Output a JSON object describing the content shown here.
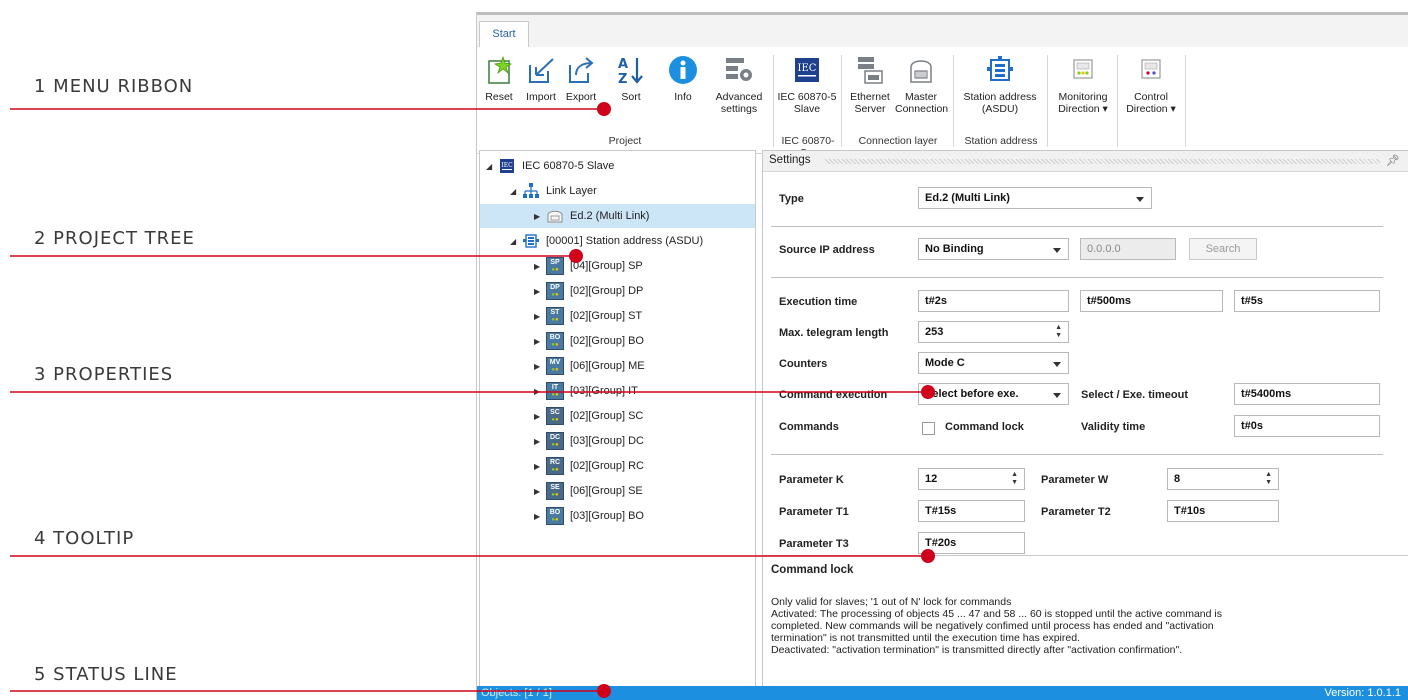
{
  "callouts": [
    "1 MENU RIBBON",
    "2 PROJECT TREE",
    "3 PROPERTIES",
    "4 TOOLTIP",
    "5 STATUS LINE"
  ],
  "colors": {
    "callout_line": "#d0021b",
    "status_bar": "#1c8fe0",
    "selection": "#cde6f7"
  },
  "tabs": {
    "start": "Start"
  },
  "ribbon": {
    "reset": "Reset",
    "import": "Import",
    "export": "Export",
    "sort": "Sort",
    "info": "Info",
    "advanced_1": "Advanced",
    "advanced_2": "settings",
    "iec_1": "IEC 60870-5",
    "iec_2": "Slave",
    "eth_1": "Ethernet",
    "eth_2": "Server",
    "master_1": "Master",
    "master_2": "Connection",
    "station_1": "Station address",
    "station_2": "(ASDU)",
    "mon_1": "Monitoring",
    "mon_2": "Direction ▾",
    "ctrl_1": "Control",
    "ctrl_2": "Direction ▾",
    "group_project": "Project",
    "group_iec": "IEC 60870-5...",
    "group_conn": "Connection layer",
    "group_station": "Station address",
    "iec_badge": "IEC"
  },
  "tree": {
    "root": "IEC 60870-5 Slave",
    "link_layer": "Link Layer",
    "ed2": "Ed.2 (Multi Link)",
    "station": "[00001] Station address (ASDU)",
    "groups": [
      {
        "badge": "SP",
        "label": "[04][Group] SP"
      },
      {
        "badge": "DP",
        "label": "[02][Group] DP"
      },
      {
        "badge": "ST",
        "label": "[02][Group] ST"
      },
      {
        "badge": "BO",
        "label": "[02][Group] BO"
      },
      {
        "badge": "MV",
        "label": "[06][Group] ME"
      },
      {
        "badge": "IT",
        "label": "[03][Group] IT"
      },
      {
        "badge": "SC",
        "label": "[02][Group] SC"
      },
      {
        "badge": "DC",
        "label": "[03][Group] DC"
      },
      {
        "badge": "RC",
        "label": "[02][Group] RC"
      },
      {
        "badge": "SE",
        "label": "[06][Group] SE"
      },
      {
        "badge": "BO",
        "label": "[03][Group] BO"
      }
    ]
  },
  "settings": {
    "title": "Settings",
    "type_label": "Type",
    "type_value": "Ed.2 (Multi Link)",
    "source_ip_label": "Source IP address",
    "binding_value": "No Binding",
    "ip_value": "0.0.0.0",
    "search_button": "Search",
    "exec_time_label": "Execution time",
    "exec_1": "t#2s",
    "exec_2": "t#500ms",
    "exec_3": "t#5s",
    "max_tel_label": "Max. telegram length",
    "max_tel_value": "253",
    "counters_label": "Counters",
    "counters_value": "Mode C",
    "cmd_exec_label": "Command execution",
    "cmd_exec_value": "Select before exe.",
    "sel_timeout_label": "Select / Exe. timeout",
    "sel_timeout_value": "t#5400ms",
    "commands_label": "Commands",
    "command_lock_label": "Command lock",
    "validity_label": "Validity time",
    "validity_value": "t#0s",
    "param_k_label": "Parameter K",
    "param_k_value": "12",
    "param_w_label": "Parameter W",
    "param_w_value": "8",
    "param_t1_label": "Parameter T1",
    "param_t1_value": "T#15s",
    "param_t2_label": "Parameter T2",
    "param_t2_value": "T#10s",
    "param_t3_label": "Parameter T3",
    "param_t3_value": "T#20s"
  },
  "tooltip": {
    "title": "Command lock",
    "lines": [
      "Only valid for slaves; '1 out of N' lock for commands",
      "Activated: The processing of objects 45 ... 47 and 58 ... 60 is stopped until the active command is",
      "completed. New commands will be negatively confimed until process has ended and \"activation",
      "termination\" is not transmitted until the execution time has expired.",
      "Deactivated: \"activation termination\" is transmitted directly after \"activation confirmation\"."
    ]
  },
  "status": {
    "objects": "Objects: [1 / 1]",
    "version": "Version: 1.0.1.1"
  }
}
